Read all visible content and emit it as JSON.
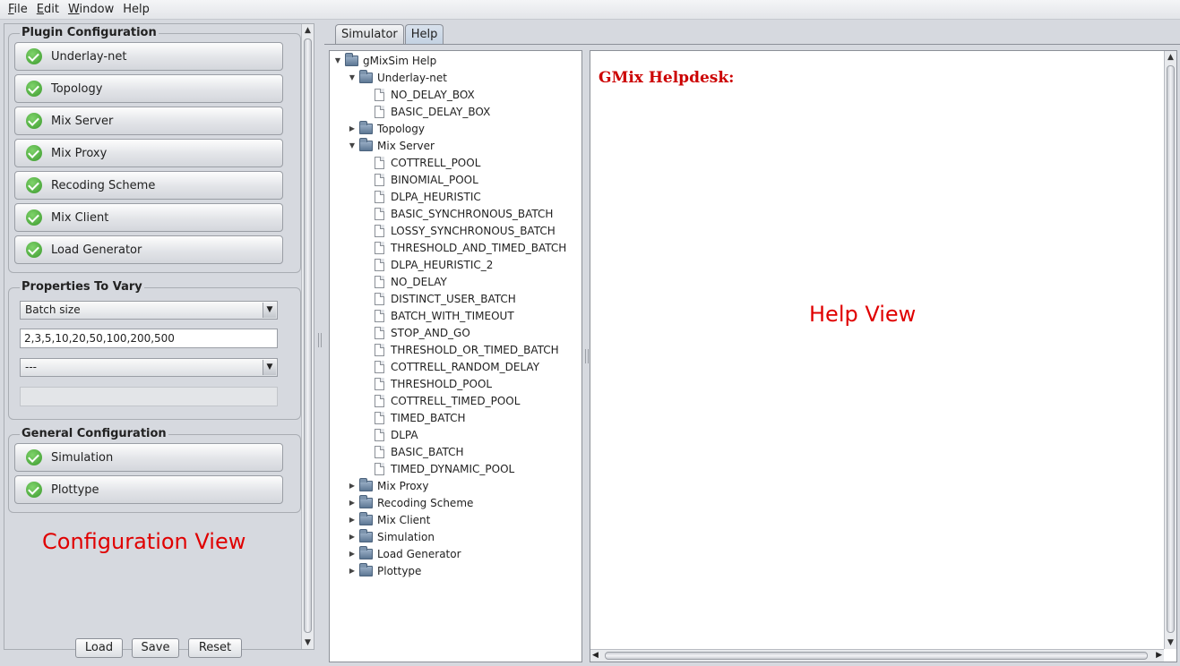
{
  "menubar": {
    "items": [
      {
        "label": "File",
        "mnemonic": "F",
        "rest": "ile"
      },
      {
        "label": "Edit",
        "mnemonic": "E",
        "rest": "dit"
      },
      {
        "label": "Window",
        "mnemonic": "W",
        "rest": "indow"
      },
      {
        "label": "Help",
        "mnemonic": "",
        "rest": "Help"
      }
    ]
  },
  "config": {
    "plugin_group_title": "Plugin Configuration",
    "plugins": [
      "Underlay-net",
      "Topology",
      "Mix Server",
      "Mix Proxy",
      "Recoding Scheme",
      "Mix Client",
      "Load Generator"
    ],
    "vary_group_title": "Properties To Vary",
    "property_select": "Batch size",
    "property_values": "2,3,5,10,20,50,100,200,500",
    "second_select": "---",
    "general_group_title": "General Configuration",
    "general_items": [
      "Simulation",
      "Plottype"
    ],
    "view_label": "Configuration View",
    "buttons": {
      "load": "Load",
      "save": "Save",
      "reset": "Reset"
    }
  },
  "tabs": [
    "Simulator",
    "Help"
  ],
  "active_tab": "Help",
  "tree": {
    "root": "gMixSim Help",
    "underlay": "Underlay-net",
    "underlay_children": [
      "NO_DELAY_BOX",
      "BASIC_DELAY_BOX"
    ],
    "topology": "Topology",
    "mix_server": "Mix Server",
    "mix_server_children": [
      "COTTRELL_POOL",
      "BINOMIAL_POOL",
      "DLPA_HEURISTIC",
      "BASIC_SYNCHRONOUS_BATCH",
      "LOSSY_SYNCHRONOUS_BATCH",
      "THRESHOLD_AND_TIMED_BATCH",
      "DLPA_HEURISTIC_2",
      "NO_DELAY",
      "DISTINCT_USER_BATCH",
      "BATCH_WITH_TIMEOUT",
      "STOP_AND_GO",
      "THRESHOLD_OR_TIMED_BATCH",
      "COTTRELL_RANDOM_DELAY",
      "THRESHOLD_POOL",
      "COTTRELL_TIMED_POOL",
      "TIMED_BATCH",
      "DLPA",
      "BASIC_BATCH",
      "TIMED_DYNAMIC_POOL"
    ],
    "collapsed_after": [
      "Mix Proxy",
      "Recoding Scheme",
      "Mix Client",
      "Simulation",
      "Load Generator",
      "Plottype"
    ]
  },
  "help": {
    "title": "GMix Helpdesk:",
    "view_label": "Help View"
  },
  "colors": {
    "accent_red": "#e00000",
    "check_green": "#3c9a2e"
  }
}
